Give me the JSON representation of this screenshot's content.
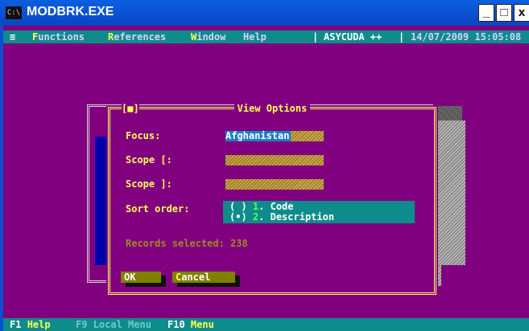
{
  "window": {
    "title": "MODBRK.EXE",
    "icon": "cmd-icon",
    "controls": {
      "minimize": "_",
      "maximize": "□",
      "close": "x"
    }
  },
  "menubar": {
    "system": "≡",
    "items": [
      {
        "hot": "F",
        "rest": "unctions"
      },
      {
        "hot": "R",
        "rest": "eferences"
      },
      {
        "hot": "W",
        "rest": "indow"
      },
      {
        "hot": "",
        "rest": "Help"
      }
    ],
    "app": "ASYCUDA ++",
    "datetime": "14/07/2009 15:05:08"
  },
  "dialog": {
    "title": "View Options",
    "close_glyph": "[■]",
    "focus": {
      "label": "Focus:",
      "value": "Afghanistan"
    },
    "scope_from": {
      "label": "Scope [:",
      "value": ""
    },
    "scope_to": {
      "label": "Scope ]:",
      "value": ""
    },
    "sort": {
      "label": "Sort order:",
      "options": [
        {
          "radio": "( )",
          "num": "1",
          "text": ". Code",
          "selected": false
        },
        {
          "radio": "(•)",
          "num": "2",
          "text": ". Description",
          "selected": true
        }
      ]
    },
    "records": "Records selected: 238",
    "ok": {
      "hot": "",
      "text": "OK"
    },
    "cancel": {
      "hot": "C",
      "text": "ancel"
    }
  },
  "statusbar": {
    "items": [
      {
        "key": "F1",
        "label": "Help",
        "enabled": true
      },
      {
        "key": "F9",
        "label": "Local Menu",
        "enabled": false
      },
      {
        "key": "F10",
        "label": "Menu",
        "enabled": true
      }
    ]
  },
  "colors": {
    "desktop": "#800080",
    "menubar": "#0e8c8c",
    "accent": "#ffff55",
    "titlebar": "#0a4fcf"
  }
}
